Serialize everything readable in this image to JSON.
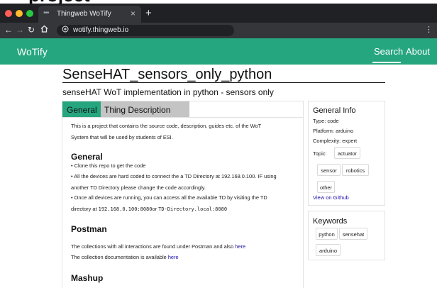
{
  "browser": {
    "tab_title": "Thingweb WoTify",
    "tab_close": "×",
    "new_tab": "+",
    "url": "wotify.thingweb.io"
  },
  "navbar": {
    "brand": "WoTify",
    "links": [
      "Search",
      "About"
    ],
    "active_link": "Search",
    "color": "#26a67f"
  },
  "thing": {
    "title": "SenseHAT_sensors_only_python",
    "subtitle": "senseHAT WoT implementation in python - sensors only"
  },
  "tabs": {
    "general": "General",
    "thing_description": "Thing Description",
    "active": "General"
  },
  "readme": {
    "intro_1": "This is a project that contains the source code, description, guides etc. of the WoT",
    "intro_2": "System that will be used by students of ESI.",
    "heading_general": "General",
    "bullet_1": "• Clone this repo to get the code",
    "bullet_2a": "• All the devices are hard coded to connect the a TD Directory at 192.168.0.100. IF using",
    "bullet_2b": "another TD Directory please change the code accordingly.",
    "bullet_3a": "• Once all devices are running, you can access all the available TD by visiting the TD",
    "bullet_3b_prefix": "directory at ",
    "bullet_3b_code1": "192.168.0.100:8080",
    "bullet_3b_or": "or ",
    "bullet_3b_code2": "TD-Directory.local:8080",
    "heading_postman": "Postman",
    "postman_1_prefix": "The collections with all interactions are found under Postman and also ",
    "postman_1_link": "here",
    "postman_2_prefix": "The collection documentation is available ",
    "postman_2_link": "here",
    "heading_mashup": "Mashup"
  },
  "general_info": {
    "heading": "General Info",
    "type": "Type: code",
    "platform": "Platform: arduino",
    "complexity": "Complexity: expert",
    "topic_label": "Topic:",
    "topics": [
      "actuator",
      "sensor",
      "robotics",
      "other"
    ],
    "github_link": "View on Github"
  },
  "keywords": {
    "heading": "Keywords",
    "items": [
      "python",
      "sensehat",
      "arduino"
    ]
  },
  "colors": {
    "accent": "#26a67f",
    "tab_inactive": "#c4c4c4",
    "link": "#1a0dab"
  }
}
